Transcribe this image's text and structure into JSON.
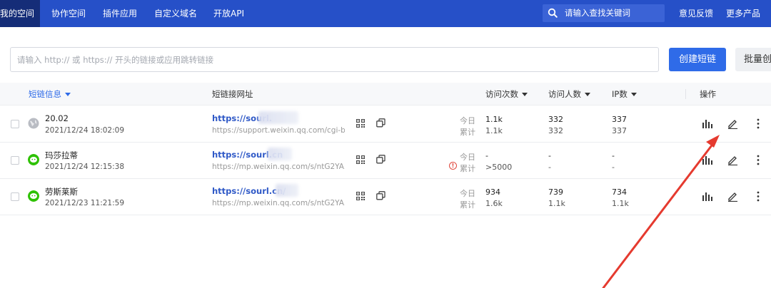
{
  "nav": {
    "items": [
      "我的空间",
      "协作空间",
      "插件应用",
      "自定义域名",
      "开放API"
    ],
    "search_placeholder": "请输入查找关键词",
    "feedback": "意见反馈",
    "more": "更多产品"
  },
  "toolbar": {
    "input_placeholder": "请输入 http:// 或 https:// 开头的链接或应用跳转链接",
    "create_label": "创建短链",
    "batch_label": "批量创"
  },
  "table": {
    "headers": {
      "info": "短链信息",
      "url": "短链接网址",
      "visits": "访问次数",
      "visitors": "访问人数",
      "ips": "IP数",
      "actions": "操作"
    },
    "today_label": "今日",
    "total_label": "累计",
    "rows": [
      {
        "icon": "globe-icon",
        "name": "20.02",
        "date": "2021/12/24 18:02:09",
        "short": "https://sourl.",
        "target": "https://support.weixin.qq.com/cgi-b...",
        "visits_today": "1.1k",
        "visits_total": "1.1k",
        "visitors_today": "332",
        "visitors_total": "332",
        "ip_today": "337",
        "ip_total": "337"
      },
      {
        "icon": "wechat-icon",
        "name": "玛莎拉蒂",
        "date": "2021/12/24 12:15:38",
        "short": "https://sourl.cn",
        "target": "https://mp.weixin.qq.com/s/ntG2YA...",
        "visits_today": "-",
        "visits_total": ">5000",
        "visitors_today": "-",
        "visitors_total": "-",
        "ip_today": "-",
        "ip_total": "-"
      },
      {
        "icon": "wechat-icon",
        "name": "劳斯莱斯",
        "date": "2021/12/23 11:21:59",
        "short": "https://sourl.cn/",
        "target": "https://mp.weixin.qq.com/s/ntG2YA...",
        "visits_today": "934",
        "visits_total": "1.6k",
        "visitors_today": "739",
        "visitors_total": "1.1k",
        "ip_today": "734",
        "ip_total": "1.1k"
      }
    ]
  },
  "colors": {
    "nav_bg": "#2650c8",
    "accent": "#2f6be8",
    "annotation_arrow": "#e53a2f"
  }
}
